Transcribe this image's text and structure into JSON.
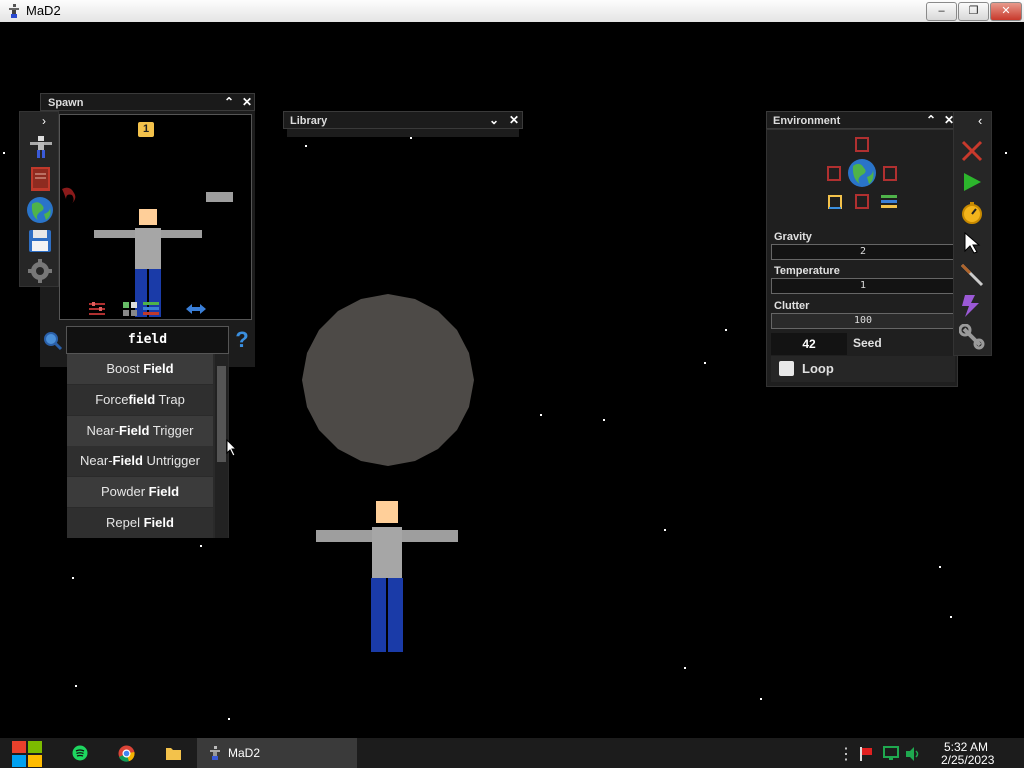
{
  "window": {
    "title": "MaD2",
    "min": "–",
    "max": "❐",
    "close": "✕"
  },
  "spawn": {
    "title": "Spawn",
    "badge": "1",
    "search_value": "field",
    "help": "?",
    "results_before": [
      "Boost ",
      "Force",
      "Near-",
      "Near-",
      "Powder ",
      "Repel "
    ],
    "results_match": [
      "Field",
      "field",
      "Field",
      "Field",
      "Field",
      "Field"
    ],
    "results_after": [
      "",
      " Trap",
      " Trigger",
      " Untrigger",
      "",
      ""
    ]
  },
  "library": {
    "title": "Library"
  },
  "environment": {
    "title": "Environment",
    "gravity_label": "Gravity",
    "gravity_value": "2",
    "temperature_label": "Temperature",
    "temperature_value": "1",
    "clutter_label": "Clutter",
    "clutter_value": "100",
    "seed_value": "42",
    "seed_label": "Seed",
    "loop_label": "Loop"
  },
  "taskbar": {
    "app_label": "MaD2",
    "time": "5:32 AM",
    "date": "2/25/2023",
    "overflow": "⋮"
  },
  "colors": {
    "accent_blue": "#3a7fd8",
    "close_red": "#c8392c",
    "play_green": "#2cb52c"
  }
}
